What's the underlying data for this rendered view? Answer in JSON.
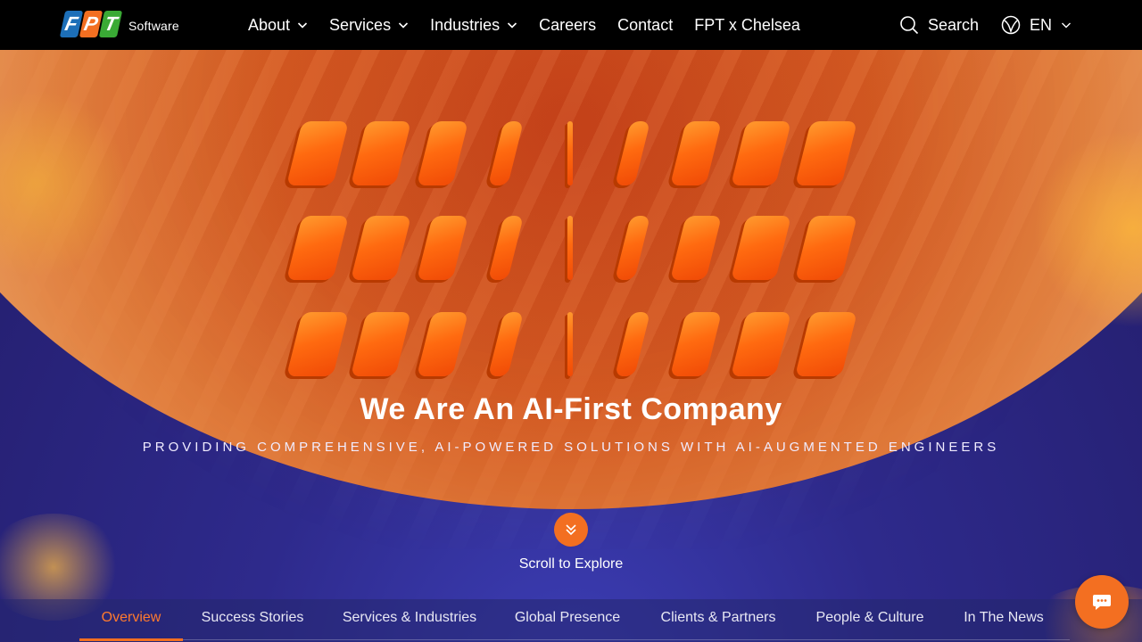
{
  "header": {
    "logo": {
      "letters": [
        "F",
        "P",
        "T"
      ],
      "word": "Software"
    },
    "nav": [
      {
        "label": "About",
        "has_dropdown": true
      },
      {
        "label": "Services",
        "has_dropdown": true
      },
      {
        "label": "Industries",
        "has_dropdown": true
      },
      {
        "label": "Careers",
        "has_dropdown": false
      },
      {
        "label": "Contact",
        "has_dropdown": false
      },
      {
        "label": "FPT x Chelsea",
        "has_dropdown": false
      }
    ],
    "search_label": "Search",
    "language": "EN"
  },
  "hero": {
    "headline": "We Are An AI-First Company",
    "subline": "PROVIDING COMPREHENSIVE, AI-POWERED SOLUTIONS WITH AI-AUGMENTED ENGINEERS",
    "scroll_label": "Scroll to Explore"
  },
  "tabs": [
    {
      "label": "Overview",
      "active": true
    },
    {
      "label": "Success Stories",
      "active": false
    },
    {
      "label": "Services & Industries",
      "active": false
    },
    {
      "label": "Global Presence",
      "active": false
    },
    {
      "label": "Clients & Partners",
      "active": false
    },
    {
      "label": "People & Culture",
      "active": false
    },
    {
      "label": "In The News",
      "active": false
    }
  ],
  "colors": {
    "brand_orange": "#f36f21",
    "brand_blue": "#1d6fb8",
    "brand_green": "#3aaa35",
    "header_bg": "#000000"
  },
  "icons": [
    "chevron-down-icon",
    "search-icon",
    "globe-icon",
    "double-chevron-down-icon",
    "chat-icon"
  ]
}
